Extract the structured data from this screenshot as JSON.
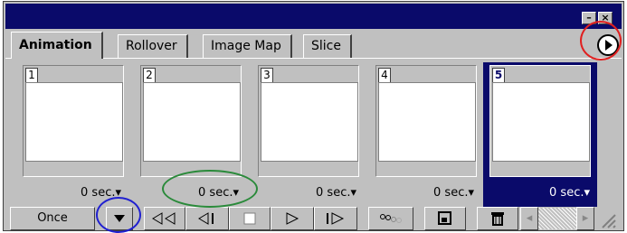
{
  "window": {
    "close_glyph": "×",
    "minimize_glyph": "–"
  },
  "tabs": [
    {
      "label": "Animation",
      "active": true
    },
    {
      "label": "Rollover",
      "active": false
    },
    {
      "label": "Image Map",
      "active": false
    },
    {
      "label": "Slice",
      "active": false
    }
  ],
  "frames": [
    {
      "number": "1",
      "delay": "0 sec.▾",
      "selected": false
    },
    {
      "number": "2",
      "delay": "0 sec.▾",
      "selected": false
    },
    {
      "number": "3",
      "delay": "0 sec.▾",
      "selected": false
    },
    {
      "number": "4",
      "delay": "0 sec.▾",
      "selected": false
    },
    {
      "number": "5",
      "delay": "0 sec.▾",
      "selected": true
    }
  ],
  "toolbar": {
    "loop_value": "Once",
    "icons": [
      "first-frame-icon",
      "previous-frame-icon",
      "stop-icon",
      "play-icon",
      "next-frame-icon",
      "tween-icon",
      "duplicate-frame-icon",
      "trash-icon"
    ]
  },
  "colors": {
    "selection": "#0a0a6a",
    "annotation_red": "#e02020",
    "annotation_green": "#2a8a3a",
    "annotation_blue": "#2020d0",
    "panel": "#c0c0c0"
  }
}
